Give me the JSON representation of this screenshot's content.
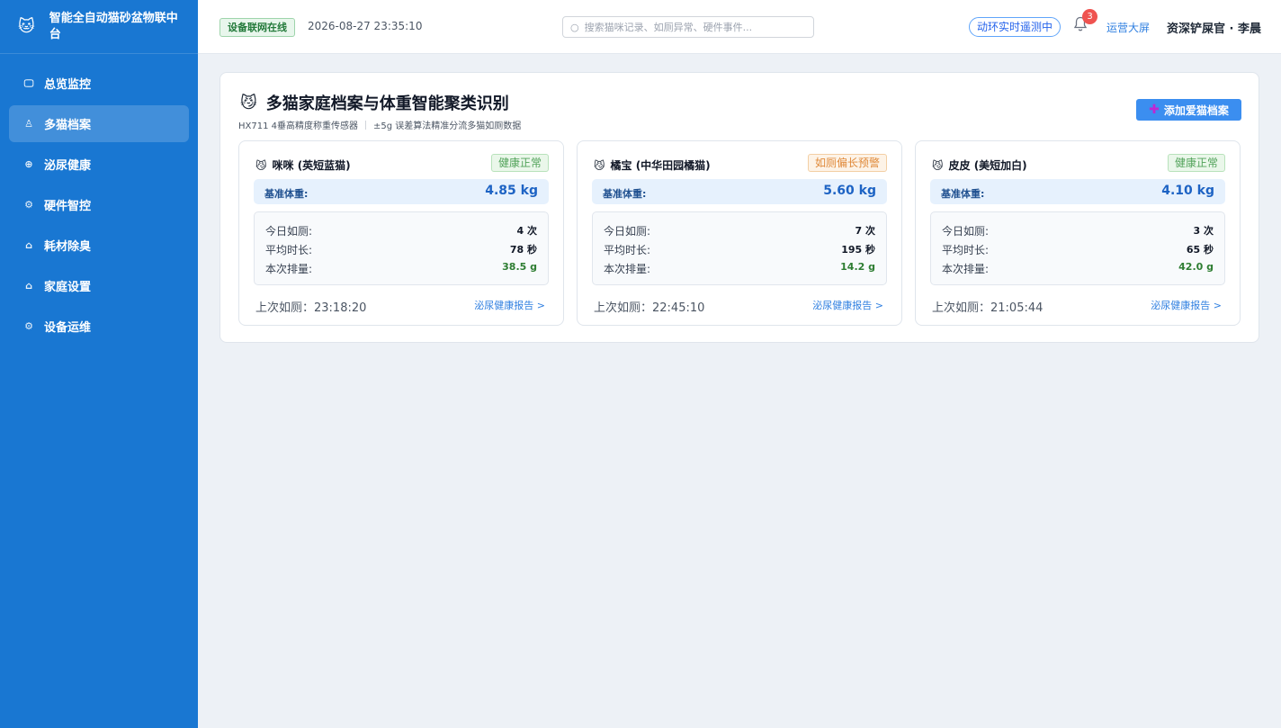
{
  "brand": {
    "logo": "🐱",
    "title": "智能全自动猫砂盆物联中台"
  },
  "sidebar": {
    "items": [
      {
        "label": "总览监控",
        "icon": "monitor-icon",
        "glyph": "🖵",
        "active": false
      },
      {
        "label": "多猫档案",
        "icon": "user-icon",
        "glyph": "♙",
        "active": true
      },
      {
        "label": "泌尿健康",
        "icon": "health-icon",
        "glyph": "⊕",
        "active": false
      },
      {
        "label": "硬件智控",
        "icon": "chip-icon",
        "glyph": "⚙",
        "active": false
      },
      {
        "label": "耗材除臭",
        "icon": "bag-icon",
        "glyph": "⌂",
        "active": false
      },
      {
        "label": "家庭设置",
        "icon": "home-icon",
        "glyph": "⌂",
        "active": false
      },
      {
        "label": "设备运维",
        "icon": "settings-icon",
        "glyph": "⚙",
        "active": false
      }
    ]
  },
  "header": {
    "online_badge": "设备联网在线",
    "clock": "2026-08-27 23:35:10",
    "search_placeholder": "搜索猫咪记录、如厕异常、硬件事件...",
    "env_pill": "动环实时遥测中",
    "bell_count": "3",
    "ops_link": "运营大屏",
    "user": "资深铲屎官 · 李晨"
  },
  "panel": {
    "emoji": "😼",
    "title": "多猫家庭档案与体重智能聚类识别",
    "sub_sensor": "HX711 4垂高精度称重传感器",
    "sub_algo": "±5g 误差算法精准分流多猫如厕数据",
    "add_button": "添加爱猫档案"
  },
  "cats": [
    {
      "name": "咪咪 (英短蓝猫)",
      "status": "健康正常",
      "status_type": "ok",
      "weight_label": "基准体重:",
      "weight": "4.85 kg",
      "today_label": "今日如厕:",
      "today": "4 次",
      "avg_label": "平均时长:",
      "avg": "78 秒",
      "output_label": "本次排量:",
      "output": "38.5 g",
      "last": "上次如厕：23:18:20",
      "report": "泌尿健康报告 >"
    },
    {
      "name": "橘宝 (中华田园橘猫)",
      "status": "如厕偏长预警",
      "status_type": "warn",
      "weight_label": "基准体重:",
      "weight": "5.60 kg",
      "today_label": "今日如厕:",
      "today": "7 次",
      "avg_label": "平均时长:",
      "avg": "195 秒",
      "output_label": "本次排量:",
      "output": "14.2 g",
      "last": "上次如厕：22:45:10",
      "report": "泌尿健康报告 >"
    },
    {
      "name": "皮皮 (美短加白)",
      "status": "健康正常",
      "status_type": "ok",
      "weight_label": "基准体重:",
      "weight": "4.10 kg",
      "today_label": "今日如厕:",
      "today": "3 次",
      "avg_label": "平均时长:",
      "avg": "65 秒",
      "output_label": "本次排量:",
      "output": "42.0 g",
      "last": "上次如厕：21:05:44",
      "report": "泌尿健康报告 >"
    }
  ]
}
